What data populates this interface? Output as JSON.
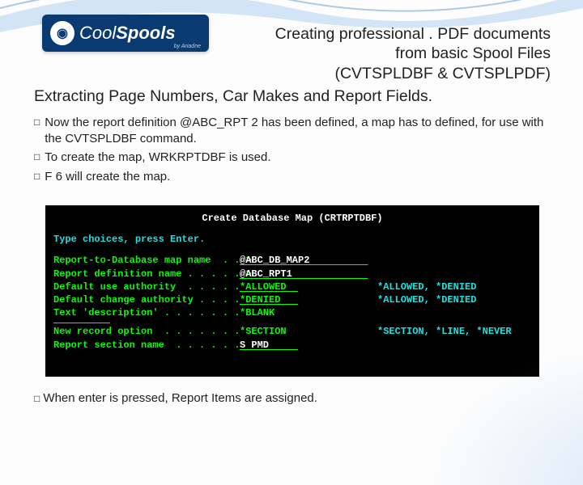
{
  "logo": {
    "brand1": "Cool",
    "brand2": "Spools",
    "sub": "by Ariadne"
  },
  "header": {
    "line1": "Creating professional . PDF documents",
    "line2": "from basic Spool Files",
    "line3": "(CVTSPLDBF & CVTSPLPDF)"
  },
  "subtitle": "Extracting Page Numbers, Car Makes and Report Fields.",
  "bullets": [
    "Now the report definition @ABC_RPT 2 has been defined, a map has to defined, for use with the CVTSPLDBF command.",
    "To create the map, WRKRPTDBF is used.",
    "F 6 will create the map."
  ],
  "terminal": {
    "title": "Create Database Map (CRTRPTDBF)",
    "prompt": "Type choices, press Enter.",
    "rows": [
      {
        "label": "Report-to-Database map name  . . >",
        "value": "@ABC_DB_MAP2          ",
        "opts": "",
        "underline": true
      },
      {
        "label": "Report definition name . . . . . >",
        "value": "@ABC_RPT1             ",
        "opts": "",
        "underline": true
      },
      {
        "label": "Default use authority  . . . . .  ",
        "value": "*ALLOWED  ",
        "opts": "*ALLOWED, *DENIED",
        "underline": true
      },
      {
        "label": "Default change authority . . . .  ",
        "value": "*DENIED   ",
        "opts": "*ALLOWED, *DENIED",
        "underline": true
      },
      {
        "label": "Text 'description' . . . . . . .  ",
        "value": "*BLANK",
        "opts": "",
        "underline": false
      }
    ],
    "section": {
      "label1": "New record option  . . . . . . .  ",
      "value1": "*SECTION",
      "opts1": "*SECTION, *LINE, *NEVER",
      "label2": "Report section name  . . . . . .  ",
      "value2": "S PMD     "
    }
  },
  "footer": "When enter is pressed, Report Items are assigned."
}
